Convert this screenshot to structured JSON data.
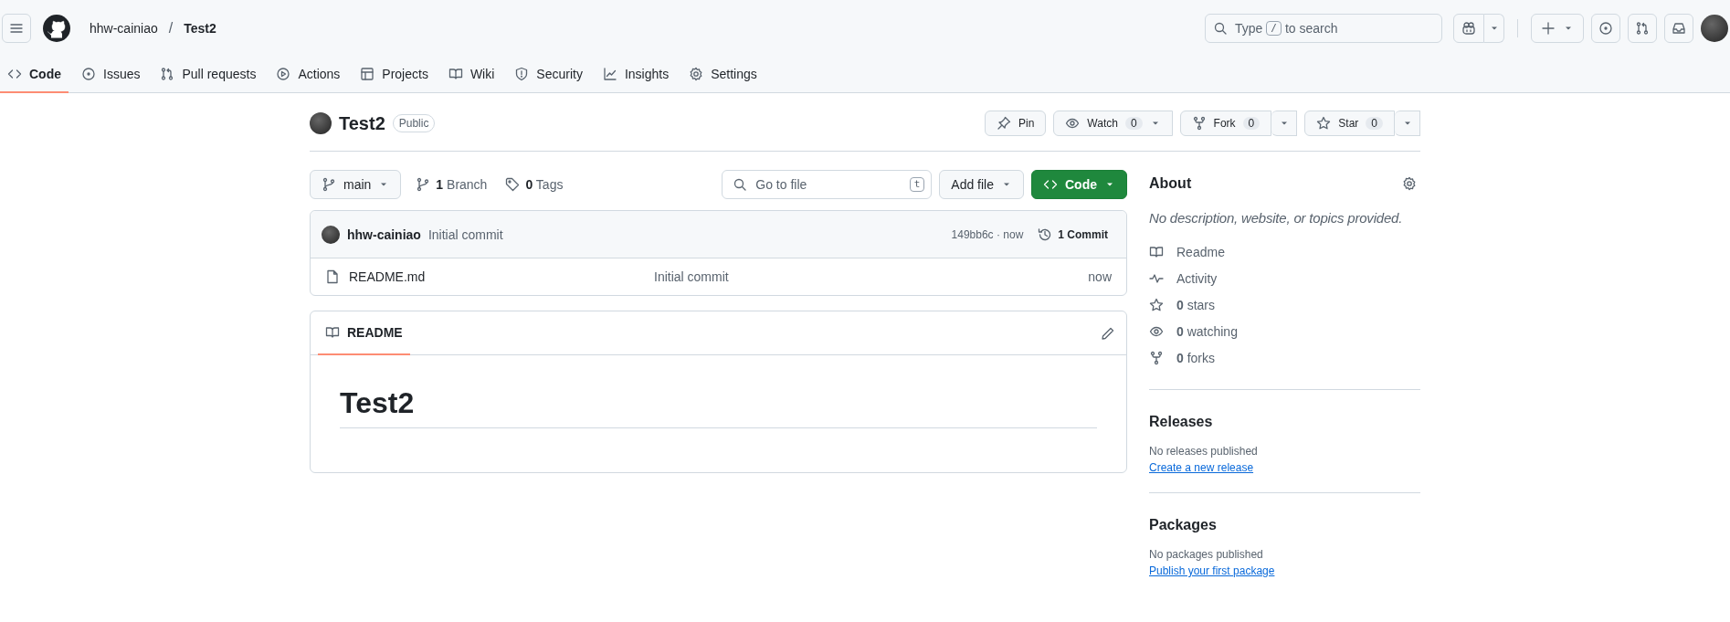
{
  "header": {
    "breadcrumb": [
      {
        "label": "hhw-cainiao",
        "current": false
      },
      {
        "label": "Test2",
        "current": true
      }
    ],
    "separator": "/",
    "search": {
      "prefix": "Type",
      "shortcut": "/",
      "suffix": "to search"
    }
  },
  "tabs": [
    {
      "label": "Code",
      "selected": true
    },
    {
      "label": "Issues",
      "selected": false
    },
    {
      "label": "Pull requests",
      "selected": false
    },
    {
      "label": "Actions",
      "selected": false
    },
    {
      "label": "Projects",
      "selected": false
    },
    {
      "label": "Wiki",
      "selected": false
    },
    {
      "label": "Security",
      "selected": false
    },
    {
      "label": "Insights",
      "selected": false
    },
    {
      "label": "Settings",
      "selected": false
    }
  ],
  "repo": {
    "name": "Test2",
    "visibility": "Public",
    "actions": [
      {
        "label": "Pin"
      },
      {
        "label": "Watch",
        "count": "0"
      },
      {
        "label": "Fork",
        "count": "0"
      },
      {
        "label": "Star",
        "count": "0"
      }
    ]
  },
  "toolbar": {
    "branch": "main",
    "branches": {
      "count": "1",
      "label": "Branch"
    },
    "tags": {
      "count": "0",
      "label": "Tags"
    },
    "go_to_file": {
      "placeholder": "Go to file",
      "shortcut": "t"
    },
    "add_file": "Add file",
    "code": "Code"
  },
  "commit": {
    "author": "hhw-cainiao",
    "message": "Initial commit",
    "sha_time": "149bb6c · now",
    "count": "1 Commit"
  },
  "files": [
    {
      "name": "README.md",
      "message": "Initial commit",
      "time": "now"
    }
  ],
  "readme": {
    "tab": "README",
    "heading": "Test2"
  },
  "about": {
    "title": "About",
    "description": "No description, website, or topics provided.",
    "items": [
      {
        "label": "Readme"
      },
      {
        "label": "Activity"
      },
      {
        "count": "0",
        "label": "stars"
      },
      {
        "count": "0",
        "label": "watching"
      },
      {
        "count": "0",
        "label": "forks"
      }
    ]
  },
  "releases": {
    "title": "Releases",
    "text": "No releases published",
    "link": "Create a new release"
  },
  "packages": {
    "title": "Packages",
    "text": "No packages published",
    "link": "Publish your first package"
  }
}
